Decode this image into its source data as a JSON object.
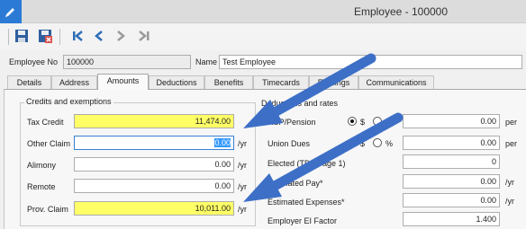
{
  "window": {
    "title": "Employee - 100000"
  },
  "header": {
    "employee_no_label": "Employee No",
    "employee_no_value": "100000",
    "name_label": "Name",
    "name_value": "Test Employee"
  },
  "tabs": [
    {
      "label": "Details"
    },
    {
      "label": "Address"
    },
    {
      "label": "Amounts",
      "active": true
    },
    {
      "label": "Deductions"
    },
    {
      "label": "Benefits"
    },
    {
      "label": "Timecards"
    },
    {
      "label": "Earnings"
    },
    {
      "label": "Communications"
    }
  ],
  "credits": {
    "title": "Credits and exemptions",
    "rows": [
      {
        "label": "Tax Credit",
        "value": "11,474.00",
        "unit": ""
      },
      {
        "label": "Other Claim",
        "value": "0.00",
        "unit": "/yr"
      },
      {
        "label": "Alimony",
        "value": "0.00",
        "unit": "/yr"
      },
      {
        "label": "Remote",
        "value": "0.00",
        "unit": "/yr"
      },
      {
        "label": "Prov. Claim",
        "value": "10,011.00",
        "unit": "/yr"
      }
    ]
  },
  "deductions": {
    "title": "Deductions and rates",
    "rsp_label": "RSP/Pension",
    "rsp_value": "0.00",
    "rsp_unit": "per",
    "union_label": "Union Dues",
    "union_value": "0.00",
    "union_unit": "per",
    "dollar_label": "$",
    "percent_label": "%",
    "elected_label": "Elected (TD1 Page 1)",
    "elected_value": "0",
    "est_pay_label": "Estimated Pay*",
    "est_pay_value": "0.00",
    "est_pay_unit": "/yr",
    "est_exp_label": "Estimated Expenses*",
    "est_exp_value": "0.00",
    "est_exp_unit": "/yr",
    "ei_label": "Employer EI Factor",
    "ei_value": "1.400"
  },
  "icons": [
    "app-icon",
    "save-icon",
    "save-close-icon",
    "first-record-icon",
    "previous-record-icon",
    "next-record-icon",
    "last-record-icon"
  ],
  "colors": {
    "highlight": "#ffff66",
    "arrow": "#3d6fc7",
    "selection": "#3399ff",
    "titlebar_icon": "#2b7bd6"
  }
}
